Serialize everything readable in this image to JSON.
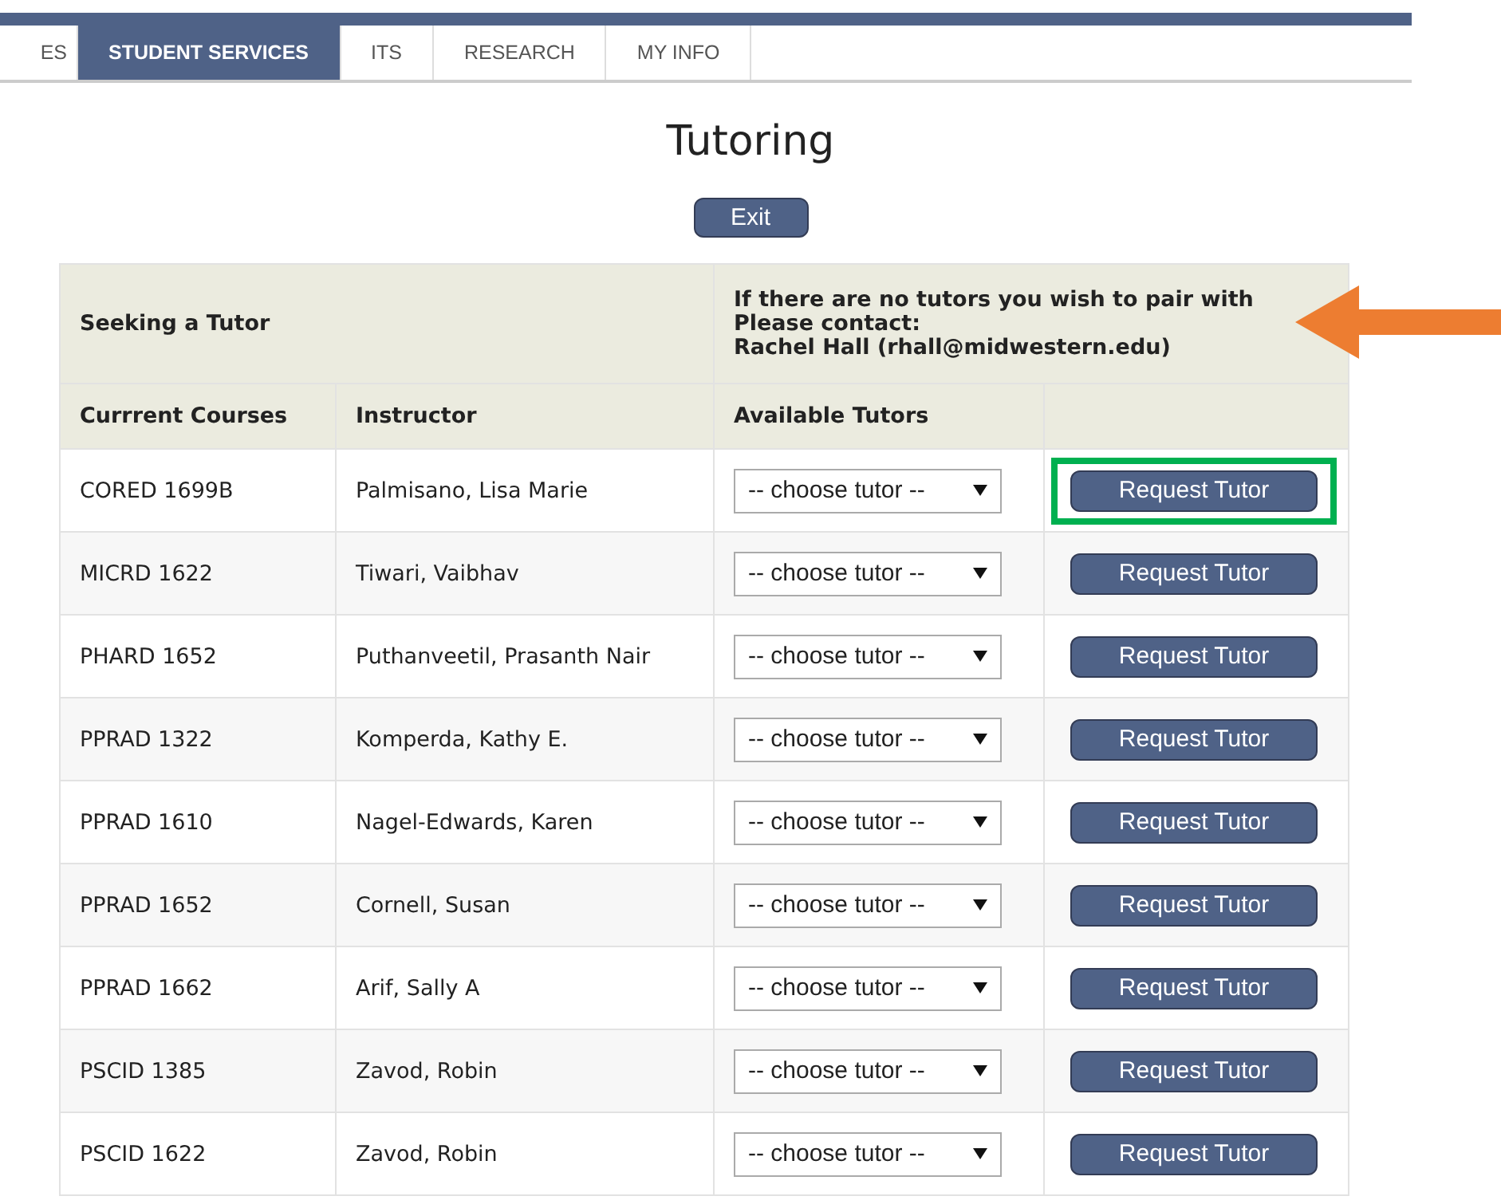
{
  "nav": {
    "tabs": [
      {
        "label": "ES",
        "selected": false
      },
      {
        "label": "STUDENT SERVICES",
        "selected": true
      },
      {
        "label": "ITS",
        "selected": false
      },
      {
        "label": "RESEARCH",
        "selected": false
      },
      {
        "label": "MY INFO",
        "selected": false
      }
    ]
  },
  "title": "Tutoring",
  "exit_button": "Exit",
  "table": {
    "section_title": "Seeking a Tutor",
    "contact_note": [
      "If there are no tutors you wish to pair with",
      "Please contact:",
      "Rachel Hall (rhall@midwestern.edu)"
    ],
    "columns": [
      "Currrent Courses",
      "Instructor",
      "Available Tutors"
    ],
    "rows": [
      {
        "course": "CORED 1699B",
        "instructor": "Palmisano, Lisa Marie",
        "tutor_placeholder": "-- choose tutor --",
        "button": "Request Tutor",
        "highlighted": true
      },
      {
        "course": "MICRD 1622",
        "instructor": "Tiwari, Vaibhav",
        "tutor_placeholder": "-- choose tutor --",
        "button": "Request Tutor",
        "highlighted": false
      },
      {
        "course": "PHARD 1652",
        "instructor": "Puthanveetil, Prasanth Nair",
        "tutor_placeholder": "-- choose tutor --",
        "button": "Request Tutor",
        "highlighted": false
      },
      {
        "course": "PPRAD 1322",
        "instructor": "Komperda, Kathy E.",
        "tutor_placeholder": "-- choose tutor --",
        "button": "Request Tutor",
        "highlighted": false
      },
      {
        "course": "PPRAD 1610",
        "instructor": "Nagel-Edwards, Karen",
        "tutor_placeholder": "-- choose tutor --",
        "button": "Request Tutor",
        "highlighted": false
      },
      {
        "course": "PPRAD 1652",
        "instructor": "Cornell, Susan",
        "tutor_placeholder": "-- choose tutor --",
        "button": "Request Tutor",
        "highlighted": false
      },
      {
        "course": "PPRAD 1662",
        "instructor": "Arif, Sally A",
        "tutor_placeholder": "-- choose tutor --",
        "button": "Request Tutor",
        "highlighted": false
      },
      {
        "course": "PSCID 1385",
        "instructor": "Zavod, Robin",
        "tutor_placeholder": "-- choose tutor --",
        "button": "Request Tutor",
        "highlighted": false
      },
      {
        "course": "PSCID 1622",
        "instructor": "Zavod, Robin",
        "tutor_placeholder": "-- choose tutor --",
        "button": "Request Tutor",
        "highlighted": false
      }
    ]
  }
}
